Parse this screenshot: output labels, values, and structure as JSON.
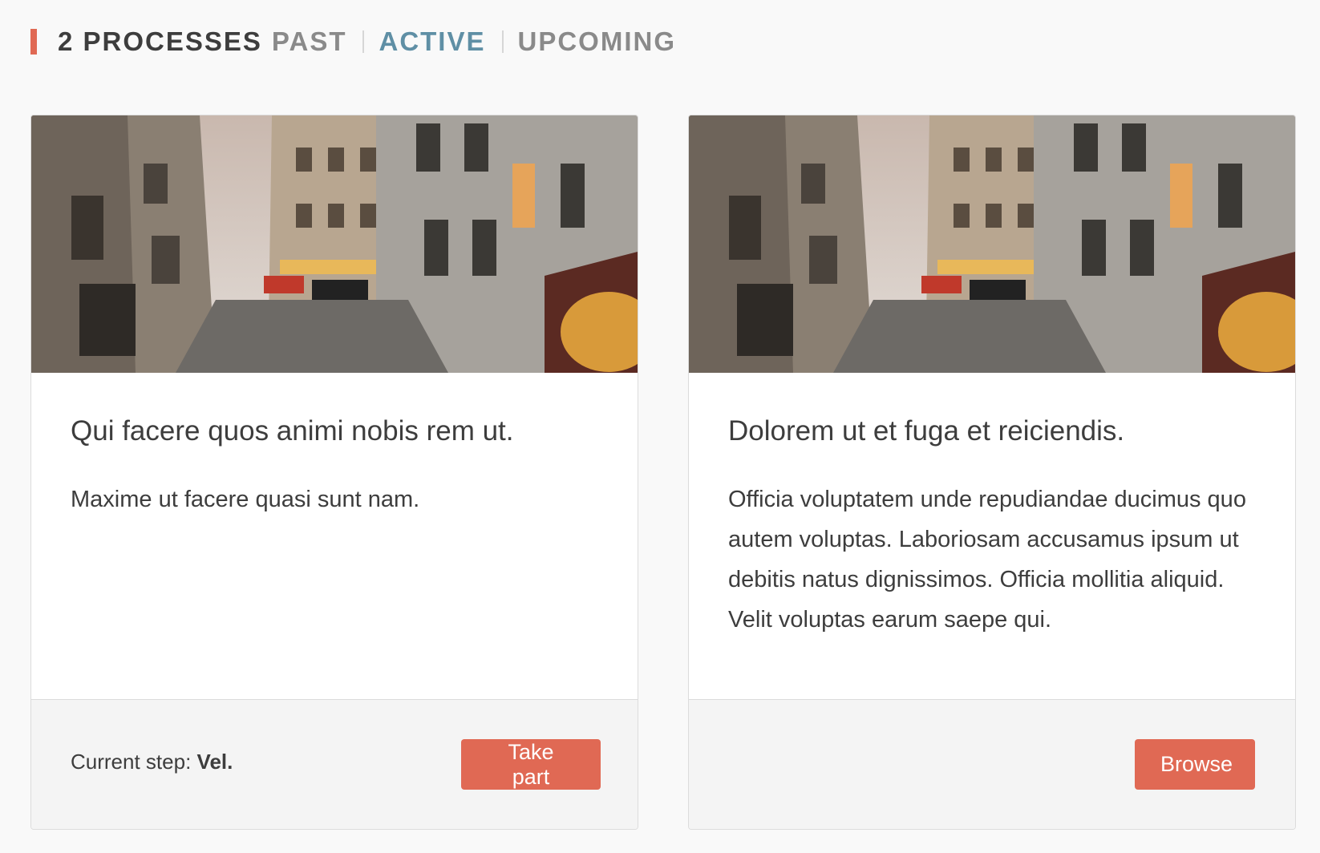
{
  "header": {
    "count_label": "2 PROCESSES",
    "filters": [
      {
        "label": "PAST",
        "active": false
      },
      {
        "label": "ACTIVE",
        "active": true
      },
      {
        "label": "UPCOMING",
        "active": false
      }
    ]
  },
  "processes": [
    {
      "title": "Qui facere quos animi nobis rem ut.",
      "description": "Maxime ut facere quasi sunt nam.",
      "step_label": "Current step:",
      "step_value": "Vel.",
      "button_label": "Take part",
      "image_icon": "paris-street-photo"
    },
    {
      "title": "Dolorem ut et fuga et reiciendis.",
      "description": "Officia voluptatem unde repudiandae ducimus quo autem voluptas. Laboriosam accusamus ipsum ut debitis natus dignissimos. Officia mollitia aliquid. Velit voluptas earum saepe qui.",
      "button_label": "Browse",
      "image_icon": "paris-street-photo"
    }
  ],
  "colors": {
    "accent": "#e06954",
    "active_filter": "#5f8fa5",
    "inactive_filter": "#8a8a8a"
  }
}
